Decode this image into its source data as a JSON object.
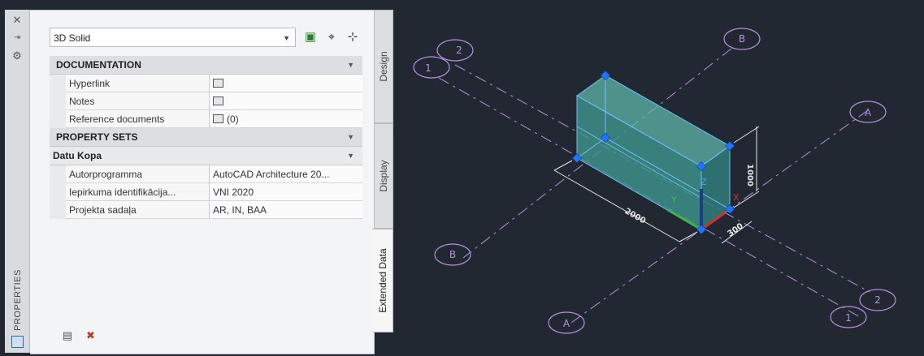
{
  "palette": {
    "title": "PROPERTIES",
    "close_icon": "close-icon",
    "autohide_icon": "autohide-icon",
    "settings_icon": "gear-icon",
    "object_selector": {
      "value": "3D Solid"
    },
    "toolbar_icons": [
      "quick-select-icon",
      "pick-add-icon",
      "select-objects-icon"
    ],
    "categories": [
      {
        "label": "DOCUMENTATION",
        "rows": [
          {
            "name": "Hyperlink",
            "value": ""
          },
          {
            "name": "Notes",
            "value": ""
          },
          {
            "name": "Reference documents",
            "value": "(0)"
          }
        ]
      },
      {
        "label": "PROPERTY SETS",
        "sub": "Datu Kopa",
        "rows": [
          {
            "name": "Autorprogramma",
            "value": "AutoCAD Architecture 20..."
          },
          {
            "name": "Iepirkuma identifikācija...",
            "value": "VNI 2020"
          },
          {
            "name": "Projekta sadaļa",
            "value": "AR, IN, BAA"
          }
        ]
      }
    ],
    "tabs": [
      "Design",
      "Display",
      "Extended Data"
    ],
    "active_tab": "Extended Data"
  },
  "drawing": {
    "grid_labels": [
      "1",
      "2",
      "B",
      "A",
      "B",
      "A",
      "2",
      "1"
    ],
    "dims": [
      "1000",
      "2000",
      "300"
    ],
    "colors": {
      "background": "#222831",
      "grid": "#b88fe0",
      "solid": "#4aa3a0",
      "grip": "#1e74ff"
    }
  }
}
